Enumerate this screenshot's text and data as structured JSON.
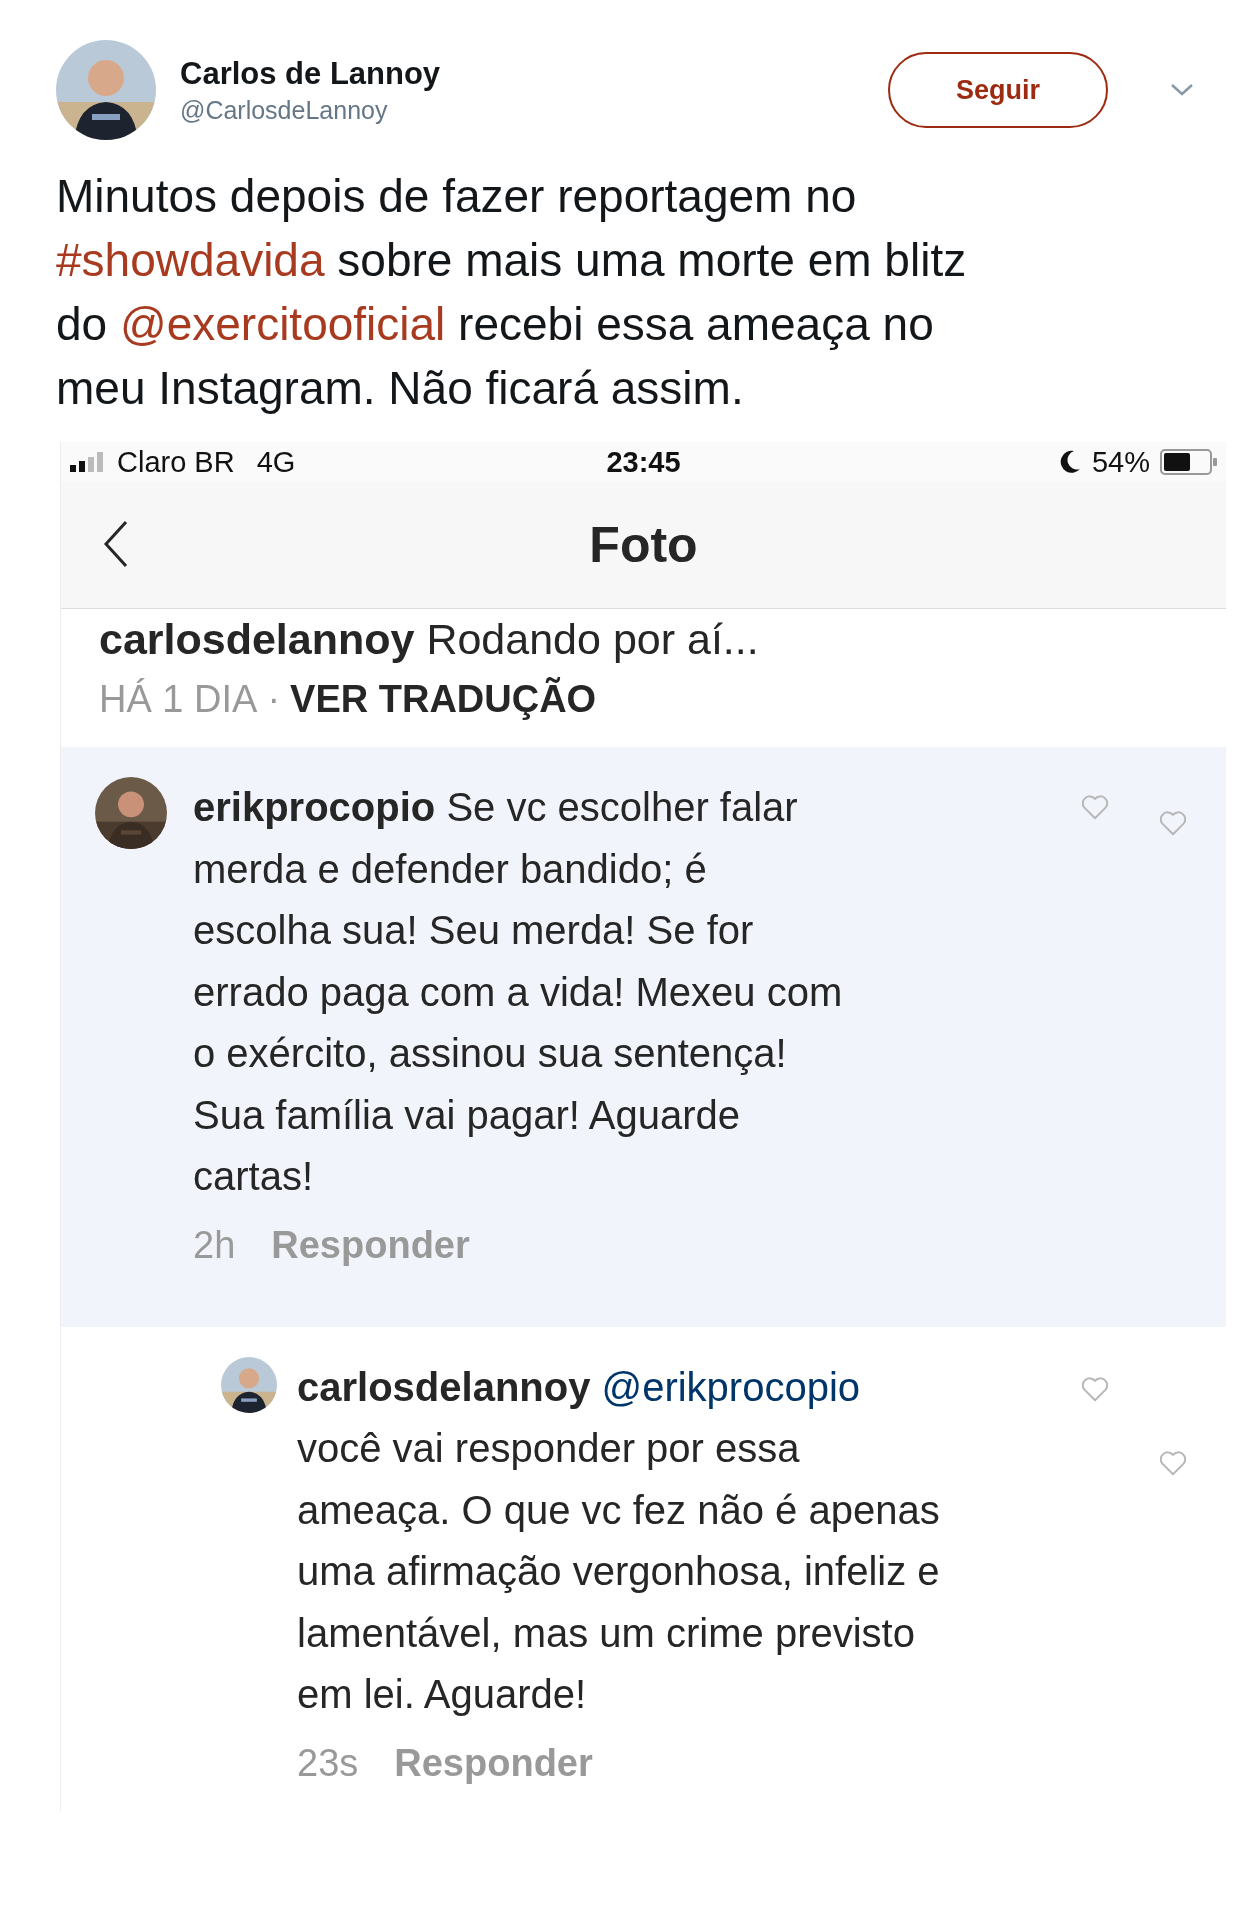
{
  "tweet": {
    "author": "Carlos de Lannoy",
    "handle": "@CarlosdeLannoy",
    "follow_button": "Seguir",
    "text": [
      {
        "kind": "text",
        "text": "Minutos depois de fazer reportagem no "
      },
      {
        "kind": "hashtag",
        "text": "#showdavida"
      },
      {
        "kind": "text",
        "text": " sobre mais uma morte em blitz do "
      },
      {
        "kind": "mention",
        "text": "@exercitooficial"
      },
      {
        "kind": "text",
        "text": " recebi essa ameaça no meu Instagram. Não ficará assim."
      }
    ]
  },
  "instagram": {
    "status_bar": {
      "carrier": "Claro BR",
      "network": "4G",
      "time": "23:45",
      "battery": "54%"
    },
    "nav_title": "Foto",
    "caption": {
      "username": "carlosdelannoy",
      "text": "Rodando por aí..."
    },
    "caption_meta": {
      "time": "HÁ 1 DIA",
      "separator": "·",
      "action": "VER TRADUÇÃO"
    },
    "comments": [
      {
        "username": "erikprocopio",
        "text": "Se vc escolher falar merda e defender bandido; é escolha sua! Seu merda! Se for errado paga com a vida! Mexeu com o exército, assinou sua sentença! Sua família vai pagar! Aguarde cartas!",
        "time": "2h",
        "reply": "Responder",
        "highlighted": true,
        "reply_level": false
      },
      {
        "username": "carlosdelannoy",
        "mention": "@erikprocopio",
        "text": "você vai responder por essa ameaça. O que vc fez não é apenas uma afirmação vergonhosa, infeliz e lamentável, mas um crime previsto em lei. Aguarde!",
        "time": "23s",
        "reply": "Responder",
        "highlighted": false,
        "reply_level": true
      }
    ]
  }
}
